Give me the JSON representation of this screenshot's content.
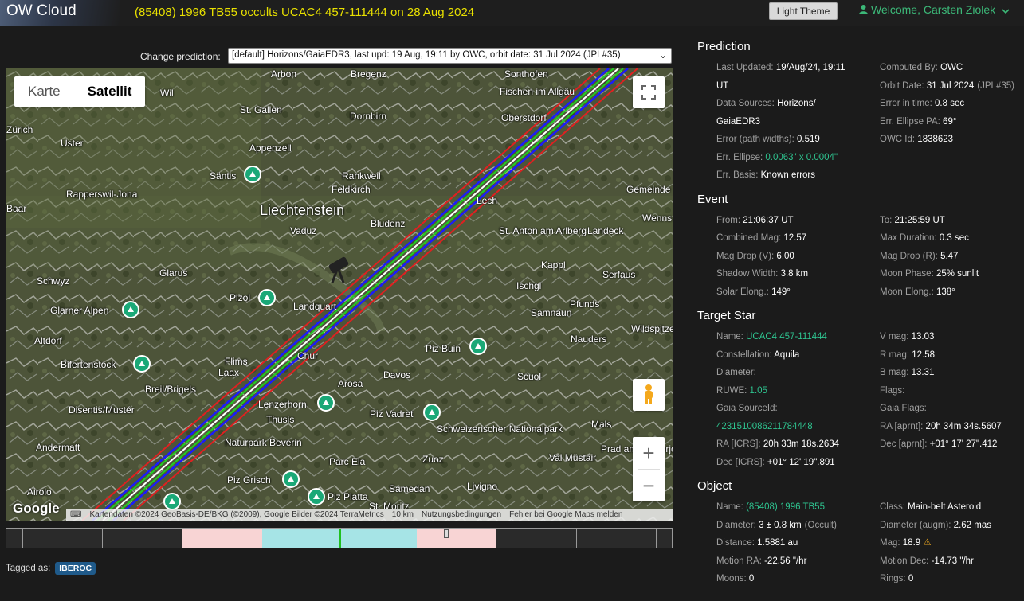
{
  "app": {
    "title": "OW Cloud"
  },
  "event_title": "(85408) 1996 TB55 occults UCAC4 457-111444 on 28 Aug 2024",
  "theme_button": "Light Theme",
  "welcome": "Welcome, Carsten Ziolek",
  "prediction_selector": {
    "label": "Change prediction:",
    "selected": "[default] Horizons/GaiaEDR3, last upd: 19 Aug, 19:11 by OWC, orbit date: 31 Jul 2024 (JPL#35)"
  },
  "map": {
    "type_buttons": [
      "Karte",
      "Satellit"
    ],
    "active_type": "Satellit",
    "labels": [
      "Arbon",
      "Bregenz",
      "Sonthofen",
      "Fischen im Allgäu",
      "Oberstdorf",
      "Wil",
      "St. Gallen",
      "Dornbirn",
      "Zürich",
      "Uster",
      "Appenzell",
      "Säntis",
      "Rankweil",
      "Feldkirch",
      "Rapperswil-Jona",
      "Liechtenstein",
      "Bludenz",
      "Lech",
      "Gemeinde",
      "Baar",
      "Vaduz",
      "St. Anton am Arlberg",
      "Landeck",
      "Wenns",
      "Glarus",
      "Kappl",
      "Serfaus",
      "Schwyz",
      "Pizol",
      "Ischgl",
      "Glarner Alpen",
      "Landquart",
      "Samnaun",
      "Pfunds",
      "Wildspitze",
      "Altdorf",
      "Chur",
      "Piz Buin",
      "Nauders",
      "Bifertenstock",
      "Flims",
      "Laax",
      "Davos",
      "Scuol",
      "Breil/Brigels",
      "Arosa",
      "Disentis/Mustér",
      "Lenzerhorn",
      "Thusis",
      "Piz Vadret",
      "Mals",
      "Schweizerischer Nationalpark",
      "Andermatt",
      "Naturpark Beverin",
      "Prad am Stilfserjoch",
      "Val Müstair",
      "Zuoz",
      "Parc Ela",
      "Piz Grisch",
      "Samedan",
      "Livigno",
      "Airolo",
      "Piz Platta",
      "St. Moritz"
    ],
    "attribution": [
      "Kartendaten ©2024 GeoBasis-DE/BKG (©2009), Google Bilder ©2024 TerraMetrics",
      "10 km",
      "Nutzungsbedingungen",
      "Fehler bei Google Maps melden"
    ],
    "google_logo": "Google",
    "zoom_in": "+",
    "zoom_out": "−"
  },
  "tags": {
    "label": "Tagged as:",
    "items": [
      "IBEROC"
    ]
  },
  "prediction": {
    "title": "Prediction",
    "left": [
      {
        "label": "Last Updated:",
        "value": "19/Aug/24, 19:11"
      },
      {
        "label": "",
        "value": "UT"
      },
      {
        "label": "Data Sources:",
        "value": "Horizons/"
      },
      {
        "label": "",
        "value": "GaiaEDR3"
      },
      {
        "label": "Error (path widths):",
        "value": "0.519"
      },
      {
        "label": "Err. Ellipse:",
        "value": "0.0063\" x 0.0004\"",
        "green": true
      },
      {
        "label": "Err. Basis:",
        "value": "Known errors"
      }
    ],
    "right": [
      {
        "label": "Computed By:",
        "value": "OWC"
      },
      {
        "label": "Orbit Date:",
        "value": "31 Jul 2024",
        "suffix": "(JPL#35)"
      },
      {
        "label": "Error in time:",
        "value": "0.8 sec"
      },
      {
        "label": "Err. Ellipse PA:",
        "value": "69°"
      },
      {
        "label": "OWC Id:",
        "value": "1838623"
      }
    ]
  },
  "event": {
    "title": "Event",
    "left": [
      {
        "label": "From:",
        "value": "21:06:37 UT"
      },
      {
        "label": "Combined Mag:",
        "value": "12.57"
      },
      {
        "label": "Mag Drop (V):",
        "value": "6.00"
      },
      {
        "label": "Shadow Width:",
        "value": "3.8 km"
      },
      {
        "label": "Solar Elong.:",
        "value": "149°"
      }
    ],
    "right": [
      {
        "label": "To:",
        "value": "21:25:59 UT"
      },
      {
        "label": "Max Duration:",
        "value": "0.3 sec"
      },
      {
        "label": "Mag Drop (R):",
        "value": "5.47"
      },
      {
        "label": "Moon Phase:",
        "value": "25% sunlit"
      },
      {
        "label": "Moon Elong.:",
        "value": "138°"
      }
    ]
  },
  "target_star": {
    "title": "Target Star",
    "left": [
      {
        "label": "Name:",
        "value": "UCAC4 457-111444",
        "green": true
      },
      {
        "label": "Constellation:",
        "value": "Aquila"
      },
      {
        "label": "Diameter:",
        "value": ""
      },
      {
        "label": "RUWE:",
        "value": "1.05",
        "green": true
      },
      {
        "label": "Gaia SourceId:",
        "value": ""
      },
      {
        "label": "",
        "value": "4231510086211784448",
        "green": true
      },
      {
        "label": "RA [ICRS]:",
        "value": "20h 33m 18s.2634"
      },
      {
        "label": "Dec [ICRS]:",
        "value": "+01° 12' 19\".891"
      }
    ],
    "right": [
      {
        "label": "V mag:",
        "value": "13.03"
      },
      {
        "label": "R mag:",
        "value": "12.58"
      },
      {
        "label": "B mag:",
        "value": "13.31"
      },
      {
        "label": "Flags:",
        "value": ""
      },
      {
        "label": "Gaia Flags:",
        "value": ""
      },
      {
        "label": "RA [aprnt]:",
        "value": "20h 34m 34s.5607"
      },
      {
        "label": "Dec [aprnt]:",
        "value": "+01° 17' 27\".412"
      },
      {
        "label": "",
        "value": ""
      }
    ]
  },
  "object": {
    "title": "Object",
    "left": [
      {
        "label": "Name:",
        "value": "(85408) 1996 TB55",
        "green": true
      },
      {
        "label": "Diameter:",
        "value": "3 ± 0.8 km",
        "suffix": "(Occult)"
      },
      {
        "label": "Distance:",
        "value": "1.5881 au"
      },
      {
        "label": "Motion RA:",
        "value": "-22.56 \"/hr"
      },
      {
        "label": "Moons:",
        "value": "0"
      }
    ],
    "right": [
      {
        "label": "Class:",
        "value": "Main-belt Asteroid"
      },
      {
        "label": "Diameter (augm):",
        "value": "2.62 mas"
      },
      {
        "label": "Mag:",
        "value": "18.9",
        "warn": true
      },
      {
        "label": "Motion Dec:",
        "value": "-14.73 \"/hr"
      },
      {
        "label": "Rings:",
        "value": "0"
      }
    ]
  },
  "colors": {
    "accent_green": "#2ec38f",
    "title_yellow": "#e8e000",
    "path_blue": "#1a1aff",
    "path_red": "#e02020",
    "path_green": "#20d020"
  }
}
